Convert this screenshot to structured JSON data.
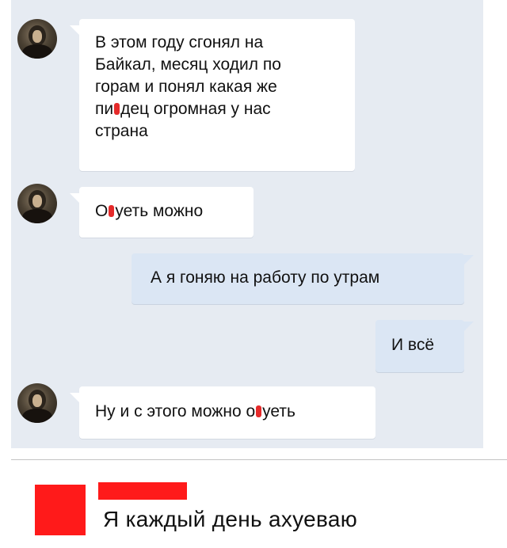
{
  "chat": {
    "messages": [
      {
        "side": "incoming",
        "text": "В этом году сгонял на\nБайкал, месяц ходил по\nгорам и понял какая же",
        "line4_a": "пи",
        "line4_b": "дец огромная у нас",
        "line5": "страна"
      },
      {
        "side": "incoming",
        "part_a": "О",
        "part_b": "уеть можно"
      },
      {
        "side": "outgoing",
        "text": "А я гоняю на работу по утрам"
      },
      {
        "side": "outgoing",
        "text": "И всё"
      },
      {
        "side": "incoming",
        "part_a": "Ну и с этого можно о",
        "part_b": "уеть"
      }
    ]
  },
  "meme": {
    "caption": "Я каждый день ахуеваю",
    "accent_color": "#ff1a1a"
  }
}
